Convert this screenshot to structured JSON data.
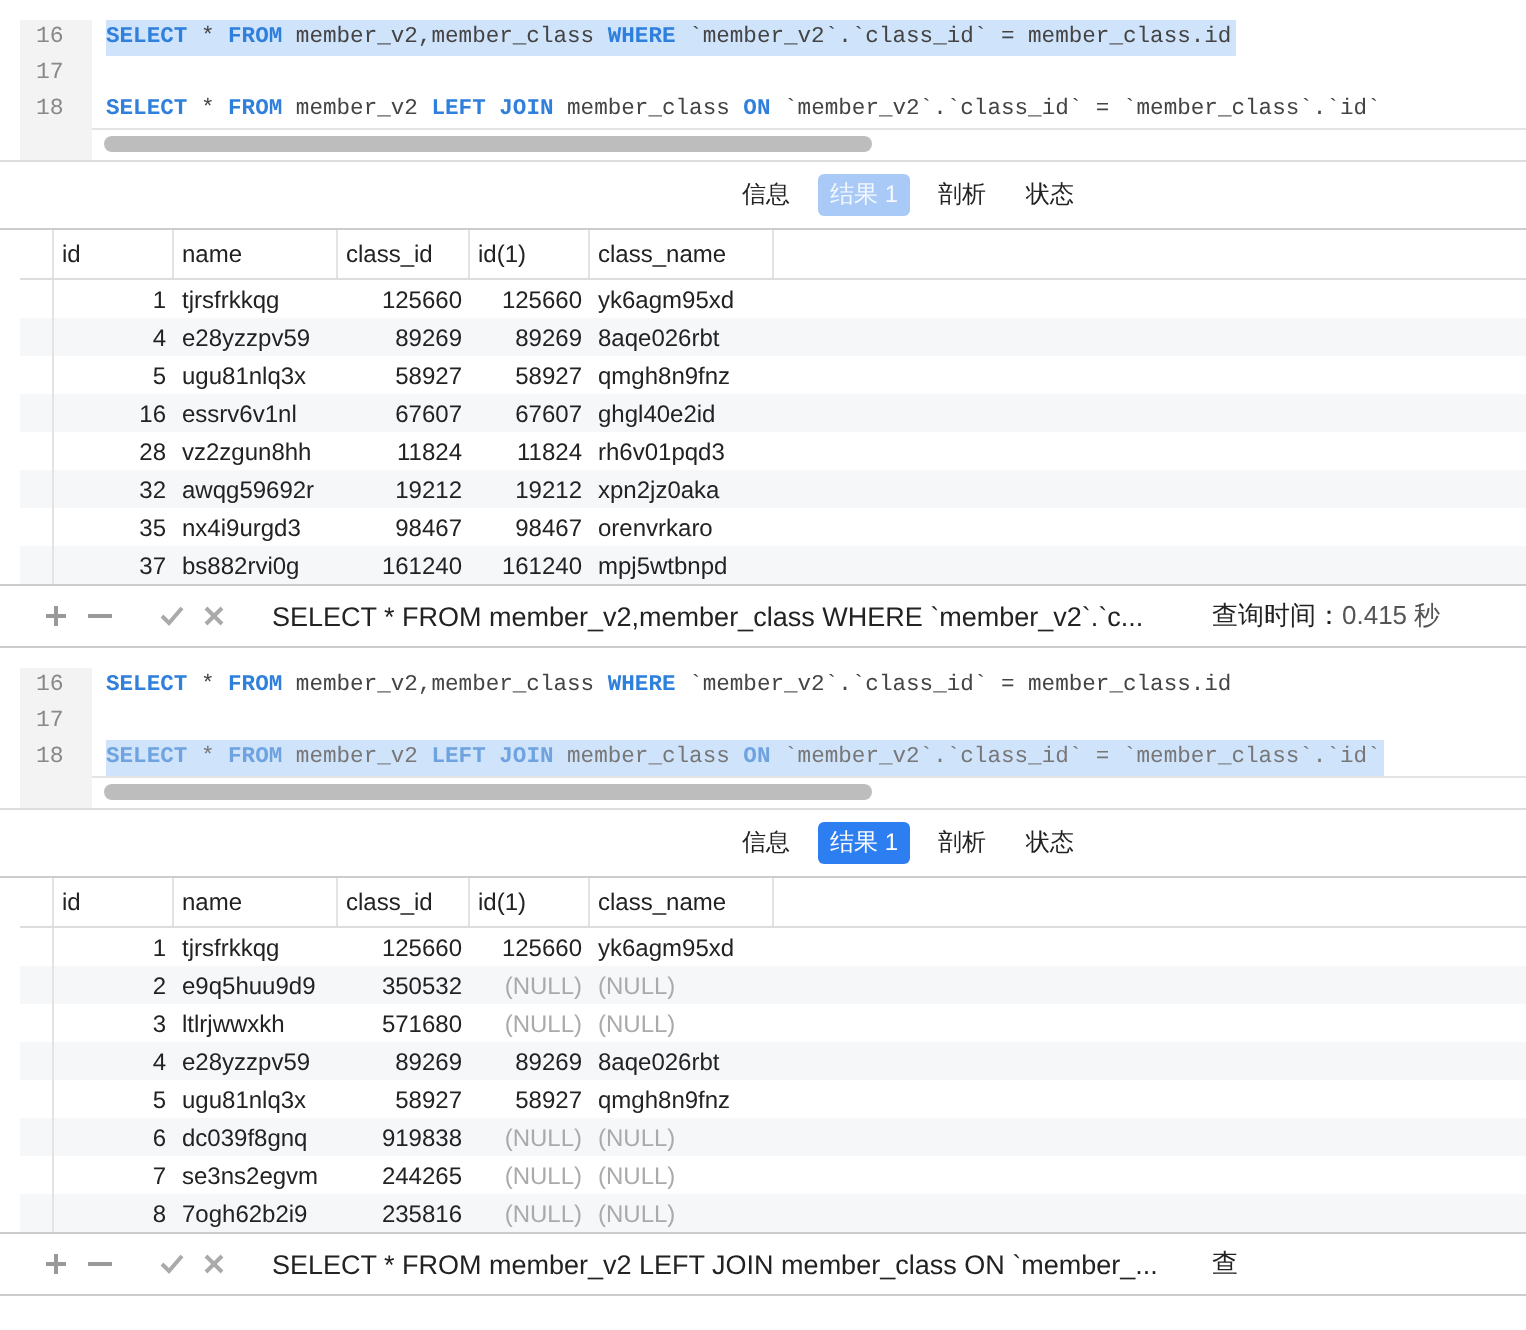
{
  "panels": [
    {
      "focused": false,
      "editor": {
        "lines": [
          {
            "number": "16",
            "selected": true,
            "tokens": [
              {
                "kind": "keyword",
                "text": "SELECT"
              },
              {
                "kind": "plain",
                "text": " * "
              },
              {
                "kind": "keyword",
                "text": "FROM"
              },
              {
                "kind": "plain",
                "text": " member_v2,member_class "
              },
              {
                "kind": "keyword",
                "text": "WHERE"
              },
              {
                "kind": "plain",
                "text": " `member_v2`.`class_id` = member_class.id"
              }
            ]
          },
          {
            "number": "17"
          },
          {
            "number": "18",
            "selected": false,
            "tokens": [
              {
                "kind": "keyword",
                "text": "SELECT"
              },
              {
                "kind": "plain",
                "text": " * "
              },
              {
                "kind": "keyword",
                "text": "FROM"
              },
              {
                "kind": "plain",
                "text": " member_v2 "
              },
              {
                "kind": "keyword",
                "text": "LEFT JOIN"
              },
              {
                "kind": "plain",
                "text": " member_class "
              },
              {
                "kind": "keyword",
                "text": "ON"
              },
              {
                "kind": "plain",
                "text": " `member_v2`.`class_id` = `member_class`.`id`"
              }
            ]
          }
        ]
      },
      "tabs": [
        {
          "label": "信息",
          "selected": false
        },
        {
          "label": "结果 1",
          "selected": true
        },
        {
          "label": "剖析",
          "selected": false
        },
        {
          "label": "状态",
          "selected": false
        }
      ],
      "table": {
        "columns": [
          "id",
          "name",
          "class_id",
          "id(1)",
          "class_name"
        ],
        "rows": [
          {
            "matched": true,
            "cells": [
              "1",
              "tjrsfrkkqg",
              "125660",
              "125660",
              "yk6agm95xd"
            ]
          },
          {
            "matched": true,
            "cells": [
              "4",
              "e28yzzpv59",
              "89269",
              "89269",
              "8aqe026rbt"
            ]
          },
          {
            "matched": true,
            "cells": [
              "5",
              "ugu81nlq3x",
              "58927",
              "58927",
              "qmgh8n9fnz"
            ]
          },
          {
            "matched": true,
            "cells": [
              "16",
              "essrv6v1nl",
              "67607",
              "67607",
              "ghgl40e2id"
            ]
          },
          {
            "matched": true,
            "cells": [
              "28",
              "vz2zgun8hh",
              "11824",
              "11824",
              "rh6v01pqd3"
            ]
          },
          {
            "matched": true,
            "cells": [
              "32",
              "awqg59692r",
              "19212",
              "19212",
              "xpn2jz0aka"
            ]
          },
          {
            "matched": true,
            "cells": [
              "35",
              "nx4i9urgd3",
              "98467",
              "98467",
              "orenvrkaro"
            ]
          },
          {
            "matched": true,
            "cells": [
              "37",
              "bs882rvi0g",
              "161240",
              "161240",
              "mpj5wtbnpd"
            ]
          }
        ]
      },
      "status_bar": {
        "query": "SELECT * FROM member_v2,member_class WHERE `member_v2`.`c...",
        "time_label": "查询时间：",
        "time_value": "0.415 秒"
      }
    },
    {
      "focused": true,
      "editor": {
        "lines": [
          {
            "number": "16",
            "selected": false,
            "tokens": [
              {
                "kind": "keyword",
                "text": "SELECT"
              },
              {
                "kind": "plain",
                "text": " * "
              },
              {
                "kind": "keyword",
                "text": "FROM"
              },
              {
                "kind": "plain",
                "text": " member_v2,member_class "
              },
              {
                "kind": "keyword",
                "text": "WHERE"
              },
              {
                "kind": "plain",
                "text": " `member_v2`.`class_id` = member_class.id"
              }
            ]
          },
          {
            "number": "17"
          },
          {
            "number": "18",
            "selected": true,
            "tokens": [
              {
                "kind": "keyword",
                "text": "SELECT"
              },
              {
                "kind": "plain",
                "text": " * "
              },
              {
                "kind": "keyword",
                "text": "FROM"
              },
              {
                "kind": "plain",
                "text": " member_v2 "
              },
              {
                "kind": "keyword",
                "text": "LEFT JOIN"
              },
              {
                "kind": "plain",
                "text": " member_class "
              },
              {
                "kind": "keyword",
                "text": "ON"
              },
              {
                "kind": "plain",
                "text": " `member_v2`.`class_id` = `member_class`.`id`"
              }
            ]
          }
        ]
      },
      "tabs": [
        {
          "label": "信息",
          "selected": false
        },
        {
          "label": "结果 1",
          "selected": true
        },
        {
          "label": "剖析",
          "selected": false
        },
        {
          "label": "状态",
          "selected": false
        }
      ],
      "table": {
        "columns": [
          "id",
          "name",
          "class_id",
          "id(1)",
          "class_name"
        ],
        "rows": [
          {
            "matched": true,
            "cells": [
              "1",
              "tjrsfrkkqg",
              "125660",
              "125660",
              "yk6agm95xd"
            ]
          },
          {
            "matched": false,
            "cells": [
              "2",
              "e9q5huu9d9",
              "350532",
              "(NULL)",
              "(NULL)"
            ]
          },
          {
            "matched": false,
            "cells": [
              "3",
              "ltlrjwwxkh",
              "571680",
              "(NULL)",
              "(NULL)"
            ]
          },
          {
            "matched": true,
            "cells": [
              "4",
              "e28yzzpv59",
              "89269",
              "89269",
              "8aqe026rbt"
            ]
          },
          {
            "matched": true,
            "cells": [
              "5",
              "ugu81nlq3x",
              "58927",
              "58927",
              "qmgh8n9fnz"
            ]
          },
          {
            "matched": false,
            "cells": [
              "6",
              "dc039f8gnq",
              "919838",
              "(NULL)",
              "(NULL)"
            ]
          },
          {
            "matched": false,
            "cells": [
              "7",
              "se3ns2egvm",
              "244265",
              "(NULL)",
              "(NULL)"
            ]
          },
          {
            "matched": false,
            "cells": [
              "8",
              "7ogh62b2i9",
              "235816",
              "(NULL)",
              "(NULL)"
            ]
          }
        ]
      },
      "status_bar": {
        "query": "SELECT * FROM member_v2 LEFT JOIN member_class ON `member_...",
        "time_label": "查"
      }
    }
  ]
}
